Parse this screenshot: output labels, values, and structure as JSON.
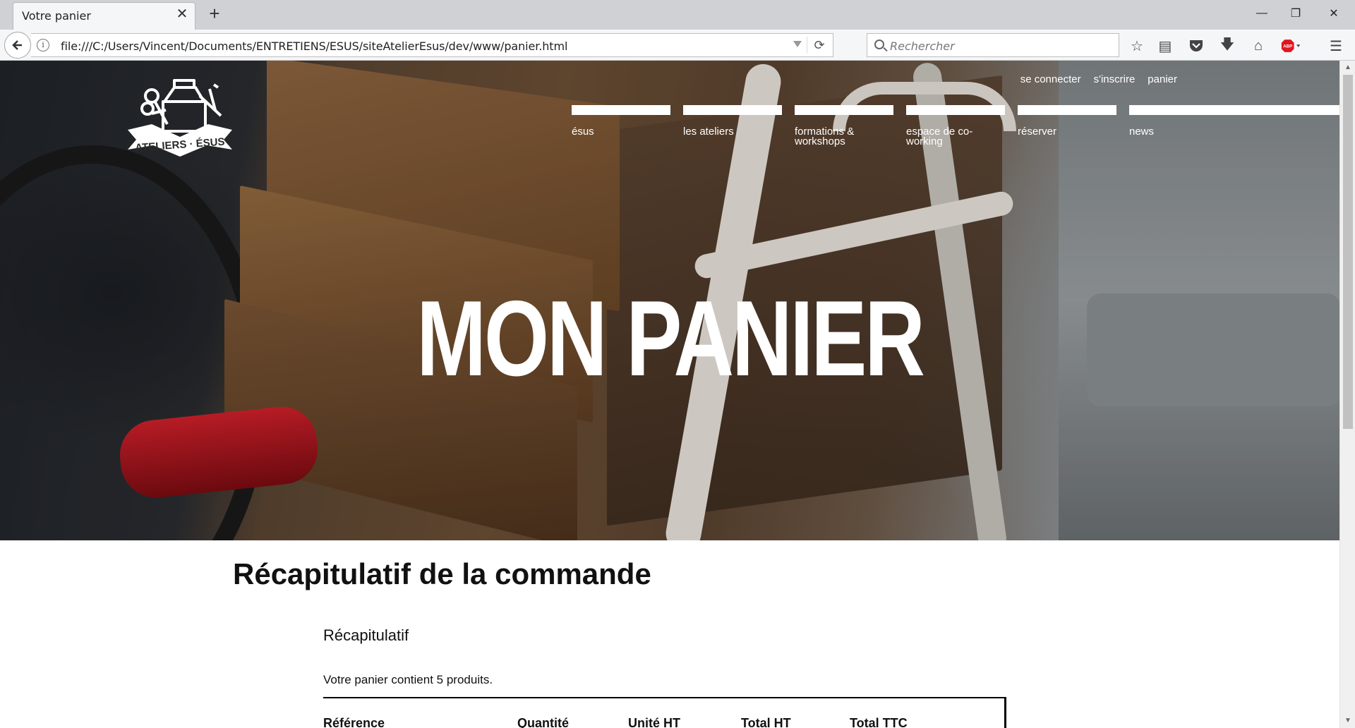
{
  "browser": {
    "tab_title": "Votre panier",
    "url": "file:///C:/Users/Vincent/Documents/ENTRETIENS/ESUS/siteAtelierEsus/dev/www/panier.html",
    "search_placeholder": "Rechercher"
  },
  "header": {
    "logo_text": "ATELIERS · ESUS",
    "top_links": [
      "se connecter",
      "s'inscrire",
      "panier"
    ],
    "nav": [
      "ésus",
      "les ateliers",
      "formations & workshops",
      "espace de co-working",
      "réserver",
      "news"
    ]
  },
  "hero": {
    "title": "MON PANIER"
  },
  "main": {
    "heading": "Récapitulatif de la commande",
    "subheading": "Récapitulatif",
    "cart_count_text": "Votre panier contient 5 produits.",
    "table_headers": [
      "Référence",
      "Quantité",
      "Unité HT",
      "Total HT",
      "Total TTC"
    ]
  }
}
